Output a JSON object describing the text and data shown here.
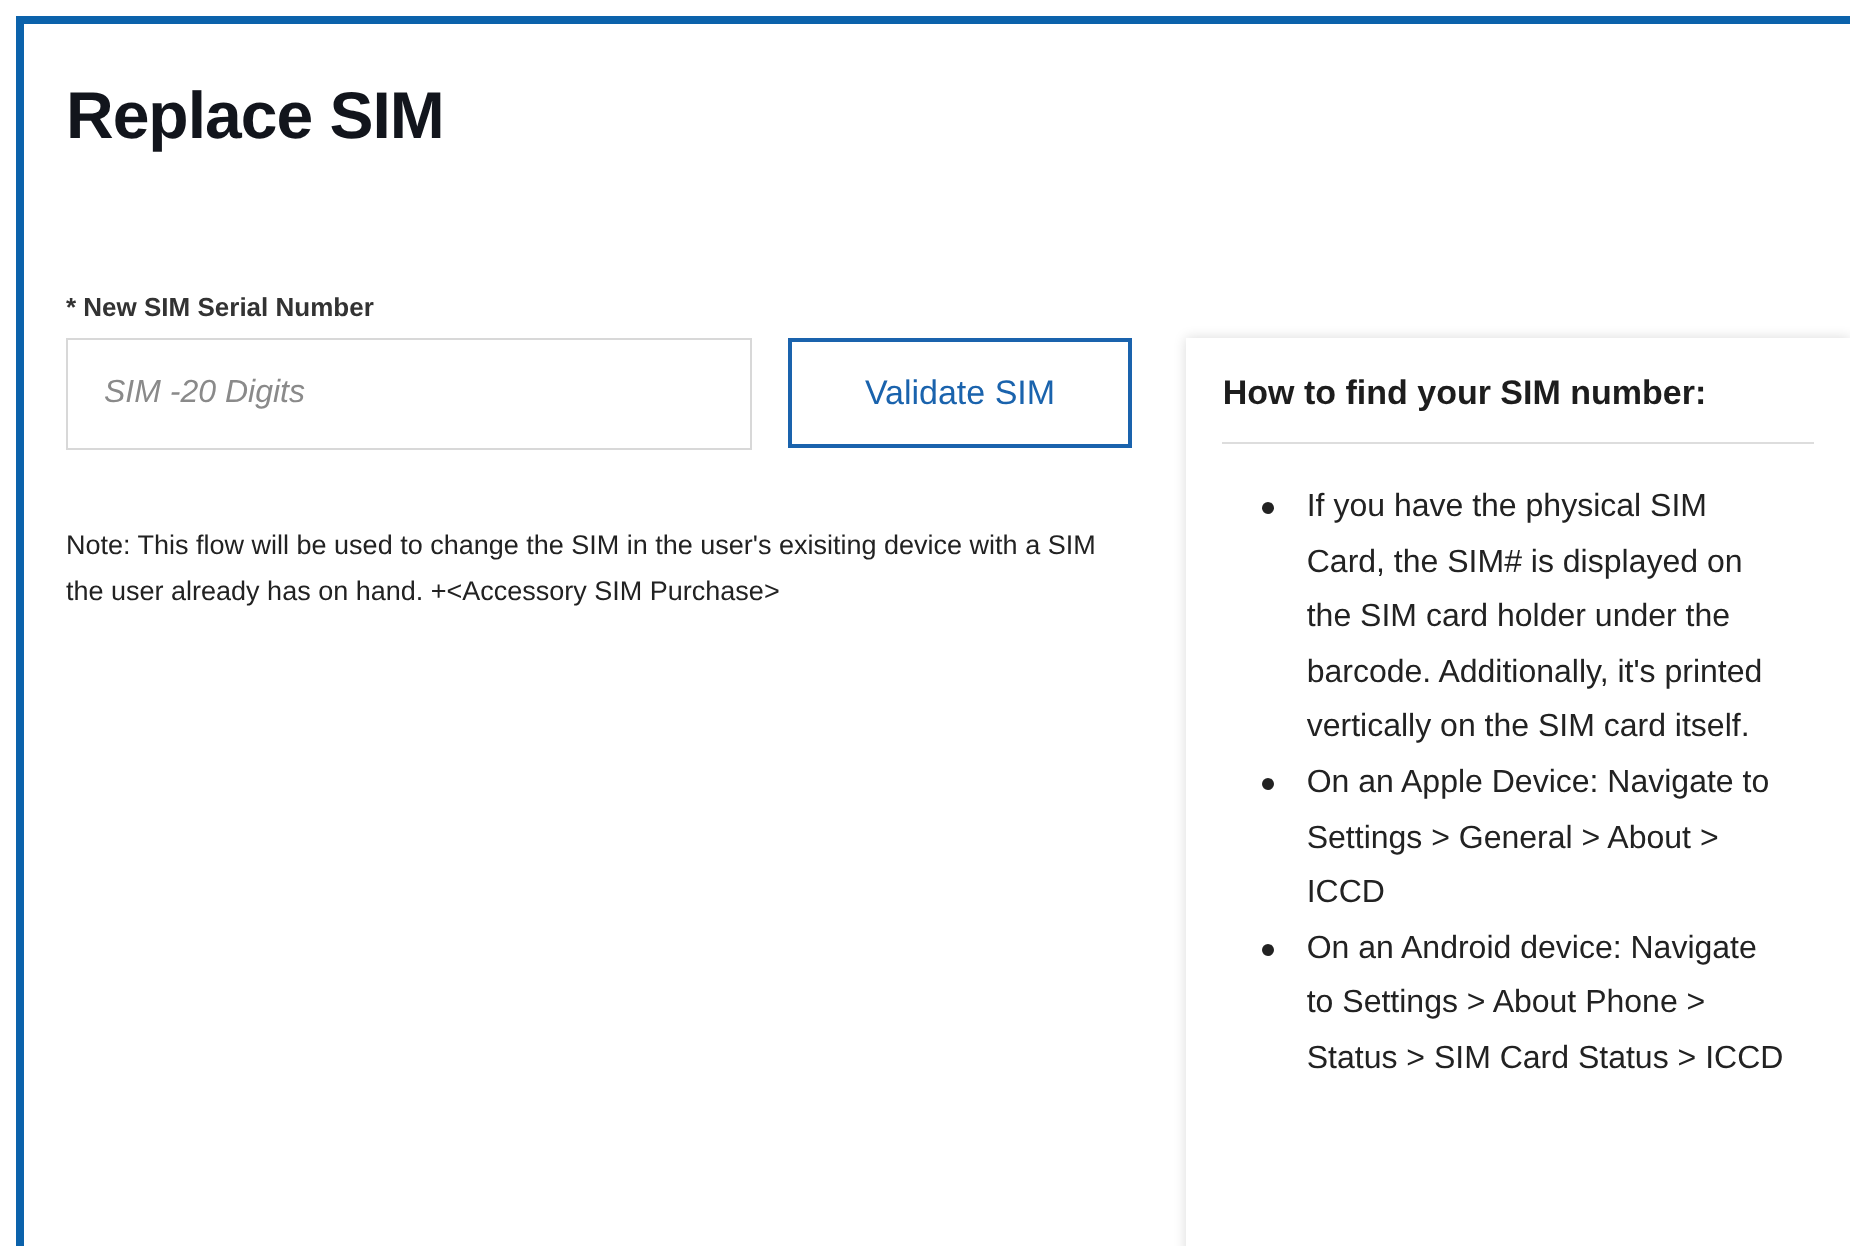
{
  "title": "Replace SIM",
  "serial_field": {
    "label": "* New SIM Serial Number",
    "placeholder": "SIM -20 Digits"
  },
  "validate_button": "Validate SIM",
  "note": "Note: This flow will be used to change the SIM in the user's exisiting device with a SIM the user already has on hand. +<Accessory SIM Purchase>",
  "help_panel": {
    "heading": "How to find your SIM number:",
    "items": [
      "If you have the physical SIM Card, the SIM# is displayed on the SIM card holder under the barcode. Additionally, it's printed vertically on the SIM card itself.",
      "On an Apple Device: Navigate to Settings > General > About > ICCD",
      "On an Android device: Navigate to Settings > About Phone > Status > SIM Card Status > ICCD"
    ]
  }
}
